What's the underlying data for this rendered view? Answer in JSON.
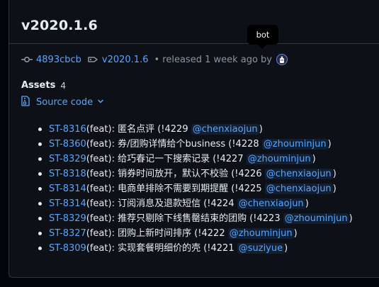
{
  "release": {
    "title": "v2020.1.6",
    "commit": "4893cbcb",
    "tag": "v2020.1.6",
    "released_text": "• released 1 week ago",
    "by_text": "by",
    "author_tooltip": "bot"
  },
  "assets": {
    "label": "Assets",
    "count": "4",
    "source_code_label": "Source code"
  },
  "changes": [
    {
      "issue": "ST-8316",
      "type": "(feat):",
      "text": "匿名点评 (!4229",
      "mention": "@chenxiaojun",
      "close": ")"
    },
    {
      "issue": "ST-8360",
      "type": "(feat):",
      "text": "券/团购详情给个business (!4228",
      "mention": "@zhouminjun",
      "close": ")"
    },
    {
      "issue": "ST-8329",
      "type": "(feat):",
      "text": "给巧春记一下搜索记录 (!4227",
      "mention": "@zhouminjun",
      "close": ")"
    },
    {
      "issue": "ST-8318",
      "type": "(feat):",
      "text": "销券时间放开，默认不校验 (!4226",
      "mention": "@chenxiaojun",
      "close": ")"
    },
    {
      "issue": "ST-8314",
      "type": "(feat):",
      "text": "电商单排除不需要到期提醒 (!4225",
      "mention": "@chenxiaojun",
      "close": ")"
    },
    {
      "issue": "ST-8314",
      "type": "(feat):",
      "text": "订阅消息及退款短信 (!4224",
      "mention": "@chenxiaojun",
      "close": ")"
    },
    {
      "issue": "ST-8329",
      "type": "(feat):",
      "text": "推荐只剔除下线售罄结束的团购 (!4223",
      "mention": "@zhouminjun",
      "close": ")"
    },
    {
      "issue": "ST-8327",
      "type": "(feat):",
      "text": "团购上新时间排序 (!4222",
      "mention": "@zhouminjun",
      "close": ")"
    },
    {
      "issue": "ST-8309",
      "type": "(feat):",
      "text": "实现套餐明细价的壳 (!4221",
      "mention": "@suziyue",
      "close": ")"
    }
  ],
  "colors": {
    "background": "#0d1117",
    "link": "#58a6ff",
    "text": "#e6edf3",
    "muted": "#8b949e"
  },
  "icons": [
    "git-commit-icon",
    "tag-icon",
    "bot-avatar-icon",
    "file-zip-icon",
    "chevron-down-icon"
  ]
}
